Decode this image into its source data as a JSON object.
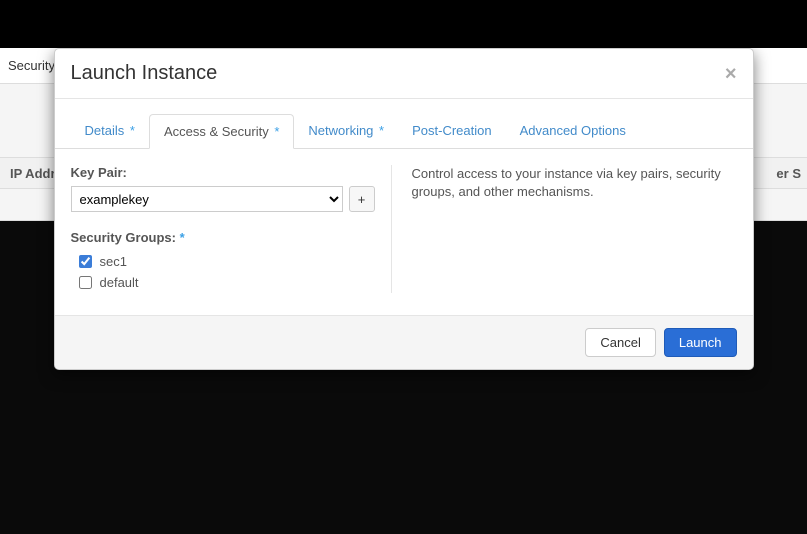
{
  "background": {
    "nav_item": "Security",
    "col_left": "IP Address",
    "col_right": "er S"
  },
  "modal": {
    "title": "Launch Instance",
    "close_glyph": "×",
    "tabs": [
      {
        "label": "Details",
        "required": true
      },
      {
        "label": "Access & Security",
        "required": true
      },
      {
        "label": "Networking",
        "required": true
      },
      {
        "label": "Post-Creation",
        "required": false
      },
      {
        "label": "Advanced Options",
        "required": false
      }
    ],
    "key_pair": {
      "label": "Key Pair:",
      "selected": "examplekey",
      "plus": "+"
    },
    "security_groups": {
      "label": "Security Groups:",
      "items": [
        {
          "name": "sec1",
          "checked": true
        },
        {
          "name": "default",
          "checked": false
        }
      ]
    },
    "help_text": "Control access to your instance via key pairs, security groups, and other mechanisms.",
    "buttons": {
      "cancel": "Cancel",
      "launch": "Launch"
    },
    "star": "*"
  }
}
